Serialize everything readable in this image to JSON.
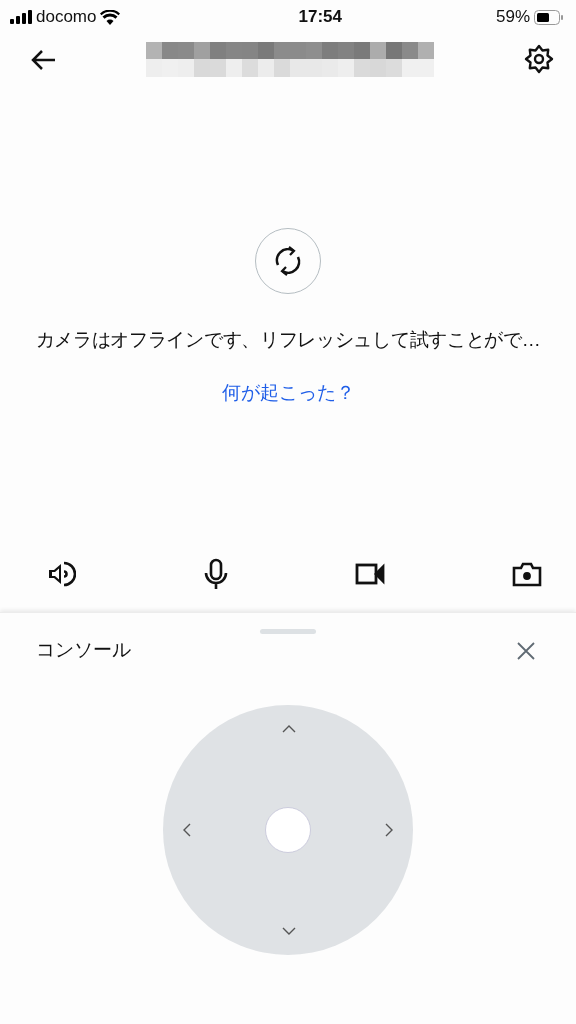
{
  "status_bar": {
    "carrier": "docomo",
    "time": "17:54",
    "battery": "59%"
  },
  "header": {
    "title": {
      "kind": "pixelated"
    }
  },
  "offline": {
    "message": "カメラはオフラインです、リフレッシュして試すことがで…",
    "link": "何が起こった？"
  },
  "controls": [
    {
      "kind": "speaker"
    },
    {
      "kind": "mic"
    },
    {
      "kind": "video"
    },
    {
      "kind": "camera"
    }
  ],
  "console": {
    "title": "コンソール"
  }
}
